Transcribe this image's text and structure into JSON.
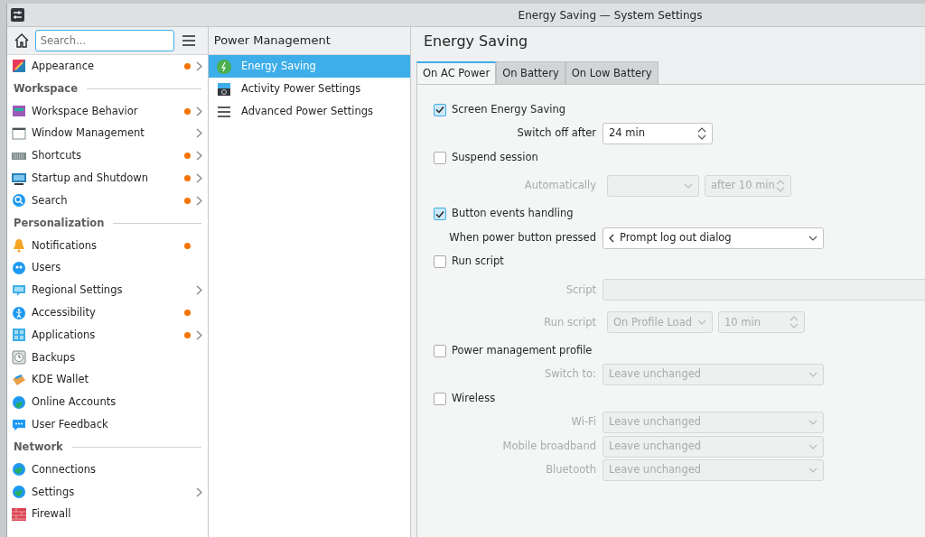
{
  "window": {
    "title": "Energy Saving — System Settings"
  },
  "search": {
    "placeholder": "Search..."
  },
  "sidebar": {
    "items": [
      {
        "kind": "item",
        "label": "Appearance",
        "changed": true,
        "submenu": true
      },
      {
        "kind": "header",
        "label": "Workspace"
      },
      {
        "kind": "item",
        "label": "Workspace Behavior",
        "changed": true,
        "submenu": true
      },
      {
        "kind": "item",
        "label": "Window Management",
        "changed": false,
        "submenu": true
      },
      {
        "kind": "item",
        "label": "Shortcuts",
        "changed": true,
        "submenu": true
      },
      {
        "kind": "item",
        "label": "Startup and Shutdown",
        "changed": true,
        "submenu": true
      },
      {
        "kind": "item",
        "label": "Search",
        "changed": true,
        "submenu": true
      },
      {
        "kind": "header",
        "label": "Personalization"
      },
      {
        "kind": "item",
        "label": "Notifications",
        "changed": true,
        "submenu": false
      },
      {
        "kind": "item",
        "label": "Users",
        "changed": false,
        "submenu": false
      },
      {
        "kind": "item",
        "label": "Regional Settings",
        "changed": false,
        "submenu": true
      },
      {
        "kind": "item",
        "label": "Accessibility",
        "changed": true,
        "submenu": false
      },
      {
        "kind": "item",
        "label": "Applications",
        "changed": true,
        "submenu": true
      },
      {
        "kind": "item",
        "label": "Backups",
        "changed": false,
        "submenu": false
      },
      {
        "kind": "item",
        "label": "KDE Wallet",
        "changed": false,
        "submenu": false
      },
      {
        "kind": "item",
        "label": "Online Accounts",
        "changed": false,
        "submenu": false
      },
      {
        "kind": "item",
        "label": "User Feedback",
        "changed": false,
        "submenu": false
      },
      {
        "kind": "header",
        "label": "Network"
      },
      {
        "kind": "item",
        "label": "Connections",
        "changed": false,
        "submenu": false
      },
      {
        "kind": "item",
        "label": "Settings",
        "changed": false,
        "submenu": true
      },
      {
        "kind": "item",
        "label": "Firewall",
        "changed": false,
        "submenu": false
      }
    ]
  },
  "subcategory": {
    "title": "Power Management",
    "items": [
      {
        "label": "Energy Saving",
        "selected": true
      },
      {
        "label": "Activity Power Settings",
        "selected": false
      },
      {
        "label": "Advanced Power Settings",
        "selected": false
      }
    ]
  },
  "page": {
    "title": "Energy Saving",
    "tabs": [
      {
        "label": "On AC Power",
        "selected": true
      },
      {
        "label": "On Battery",
        "selected": false
      },
      {
        "label": "On Low Battery",
        "selected": false
      }
    ],
    "settings": [
      {
        "kind": "checkbox",
        "label": "Screen Energy Saving",
        "checked": true
      },
      {
        "kind": "row",
        "label": "Switch off after",
        "disabled": false,
        "controls": [
          {
            "kind": "spin",
            "value": "24 min"
          }
        ]
      },
      {
        "kind": "checkbox",
        "label": "Suspend session",
        "checked": false
      },
      {
        "kind": "row",
        "label": "Automatically",
        "disabled": true,
        "controls": [
          {
            "kind": "combo"
          },
          {
            "kind": "spin",
            "value": "after 10 min"
          }
        ]
      },
      {
        "kind": "checkbox",
        "label": "Button events handling",
        "checked": true
      },
      {
        "kind": "row",
        "label": "When power button pressed",
        "disabled": false,
        "controls": [
          {
            "kind": "combo",
            "value": "Prompt log out dialog",
            "back": true
          }
        ]
      },
      {
        "kind": "checkbox",
        "label": "Run script",
        "checked": false
      },
      {
        "kind": "row",
        "label": "Script",
        "disabled": true,
        "controls": [
          {
            "kind": "text"
          }
        ]
      },
      {
        "kind": "row",
        "label": "Run script",
        "disabled": true,
        "controls": [
          {
            "kind": "combo",
            "value": "On Profile Load"
          },
          {
            "kind": "spin",
            "value": "10 min"
          }
        ]
      },
      {
        "kind": "checkbox",
        "label": "Power management profile",
        "checked": false
      },
      {
        "kind": "row",
        "label": "Switch to:",
        "disabled": true,
        "controls": [
          {
            "kind": "combo",
            "value": "Leave unchanged"
          }
        ]
      },
      {
        "kind": "checkbox",
        "label": "Wireless",
        "checked": false
      },
      {
        "kind": "row",
        "label": "Wi-Fi",
        "disabled": true,
        "controls": [
          {
            "kind": "combo",
            "value": "Leave unchanged"
          }
        ]
      },
      {
        "kind": "row",
        "label": "Mobile broadband",
        "disabled": true,
        "controls": [
          {
            "kind": "combo",
            "value": "Leave unchanged"
          }
        ]
      },
      {
        "kind": "row",
        "label": "Bluetooth",
        "disabled": true,
        "controls": [
          {
            "kind": "combo",
            "value": "Leave unchanged"
          }
        ]
      }
    ]
  }
}
